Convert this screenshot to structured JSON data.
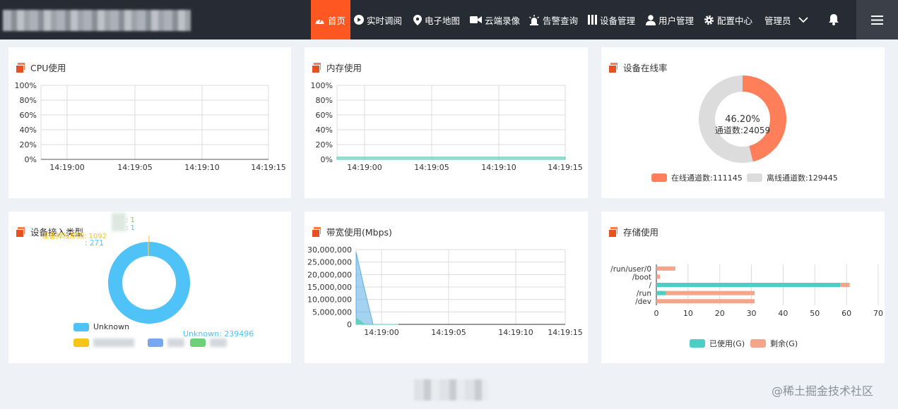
{
  "nav": {
    "items": [
      {
        "label": "首页",
        "icon": "dashboard-icon"
      },
      {
        "label": "实时调阅",
        "icon": "play-icon"
      },
      {
        "label": "电子地图",
        "icon": "map-pin-icon"
      },
      {
        "label": "云端录像",
        "icon": "video-camera-icon"
      },
      {
        "label": "告警查询",
        "icon": "alarm-light-icon"
      },
      {
        "label": "设备管理",
        "icon": "device-icon"
      },
      {
        "label": "用户管理",
        "icon": "user-icon"
      },
      {
        "label": "配置中心",
        "icon": "gear-icon"
      }
    ],
    "admin_label": "管理员",
    "active_color": "#ff5722",
    "bar_color": "#272b33"
  },
  "cpu": {
    "title": "CPU使用",
    "chart_data": {
      "type": "line",
      "y_ticks": [
        "100%",
        "80%",
        "60%",
        "40%",
        "20%",
        "0%"
      ],
      "x_ticks": [
        "14:19:00",
        "14:19:05",
        "14:19:10",
        "14:19:15"
      ],
      "ylim": [
        0,
        100
      ],
      "series": [
        {
          "values": [
            0,
            0,
            0,
            0
          ]
        }
      ]
    }
  },
  "memory": {
    "title": "内存使用",
    "chart_data": {
      "type": "area",
      "y_ticks": [
        "100%",
        "80%",
        "60%",
        "40%",
        "20%",
        "0%"
      ],
      "x_ticks": [
        "14:19:00",
        "14:19:05",
        "14:19:10",
        "14:19:15"
      ],
      "ylim": [
        0,
        100
      ],
      "series": [
        {
          "values": [
            3,
            3,
            3,
            3
          ],
          "color": "#4ecdb6"
        }
      ]
    }
  },
  "online": {
    "title": "设备在线率",
    "center_percent": "46.20%",
    "center_label": "通道数:24059",
    "chart_data": {
      "type": "pie",
      "slices": [
        {
          "label": "在线通道数:111145",
          "value": 111145,
          "color": "#ff7f5b"
        },
        {
          "label": "离线通道数:129445",
          "value": 129445,
          "color": "#dcdcdc"
        }
      ]
    }
  },
  "access": {
    "title": "设备接入类型",
    "labels": {
      "top1": ": 1",
      "top2": ": 1",
      "yellow": "设备掉线原因: 1092",
      "teal": ": 271",
      "unknown": "Unknown: 239496"
    },
    "chart_data": {
      "type": "pie",
      "slices": [
        {
          "label": "Unknown",
          "value": 239496,
          "color": "#4fc3f7"
        },
        {
          "label": "",
          "value": 1092,
          "color": "#f5c518"
        },
        {
          "label": "",
          "value": 271,
          "color": "#7aa6ef"
        },
        {
          "label": "",
          "value": 1,
          "color": "#6dd07a"
        },
        {
          "label": "",
          "value": 1,
          "color": "#4fc3f7"
        }
      ]
    },
    "legend": [
      {
        "label": "Unknown",
        "color": "#4fc3f7"
      },
      {
        "label": "",
        "color": "#f5c518"
      },
      {
        "label": "",
        "color": "#7aa6ef"
      },
      {
        "label": "",
        "color": "#6dd07a"
      }
    ]
  },
  "bandwidth": {
    "title": "带宽使用(Mbps)",
    "chart_data": {
      "type": "area",
      "y_ticks": [
        "30,000,000",
        "25,000,000",
        "20,000,000",
        "15,000,000",
        "10,000,000",
        "5,000,000",
        "0"
      ],
      "x_ticks": [
        "14:19:00",
        "14:19:05",
        "14:19:10",
        "14:19:15"
      ],
      "ylim": [
        0,
        30000000
      ],
      "series": [
        {
          "values": [
            29000000,
            14000000,
            0,
            0,
            0,
            0
          ],
          "color": "#5aaee6"
        },
        {
          "values": [
            2500000,
            0,
            0,
            0,
            0,
            0
          ],
          "color": "#4ecdb6"
        }
      ]
    }
  },
  "storage": {
    "title": "存储使用",
    "chart_data": {
      "type": "bar",
      "categories": [
        "/run/user/0",
        "/boot",
        "/",
        "/run",
        "/dev"
      ],
      "x_ticks": [
        "0",
        "10",
        "20",
        "30",
        "40",
        "50",
        "60",
        "70"
      ],
      "xlim": [
        0,
        70
      ],
      "series": [
        {
          "name": "已使用(G)",
          "color": "#4ecdc4",
          "values": [
            0,
            0.2,
            58,
            3,
            0
          ]
        },
        {
          "name": "剩余(G)",
          "color": "#f4a58a",
          "values": [
            6,
            1,
            3,
            28,
            31
          ]
        }
      ]
    }
  },
  "watermark": "@稀土掘金技术社区"
}
